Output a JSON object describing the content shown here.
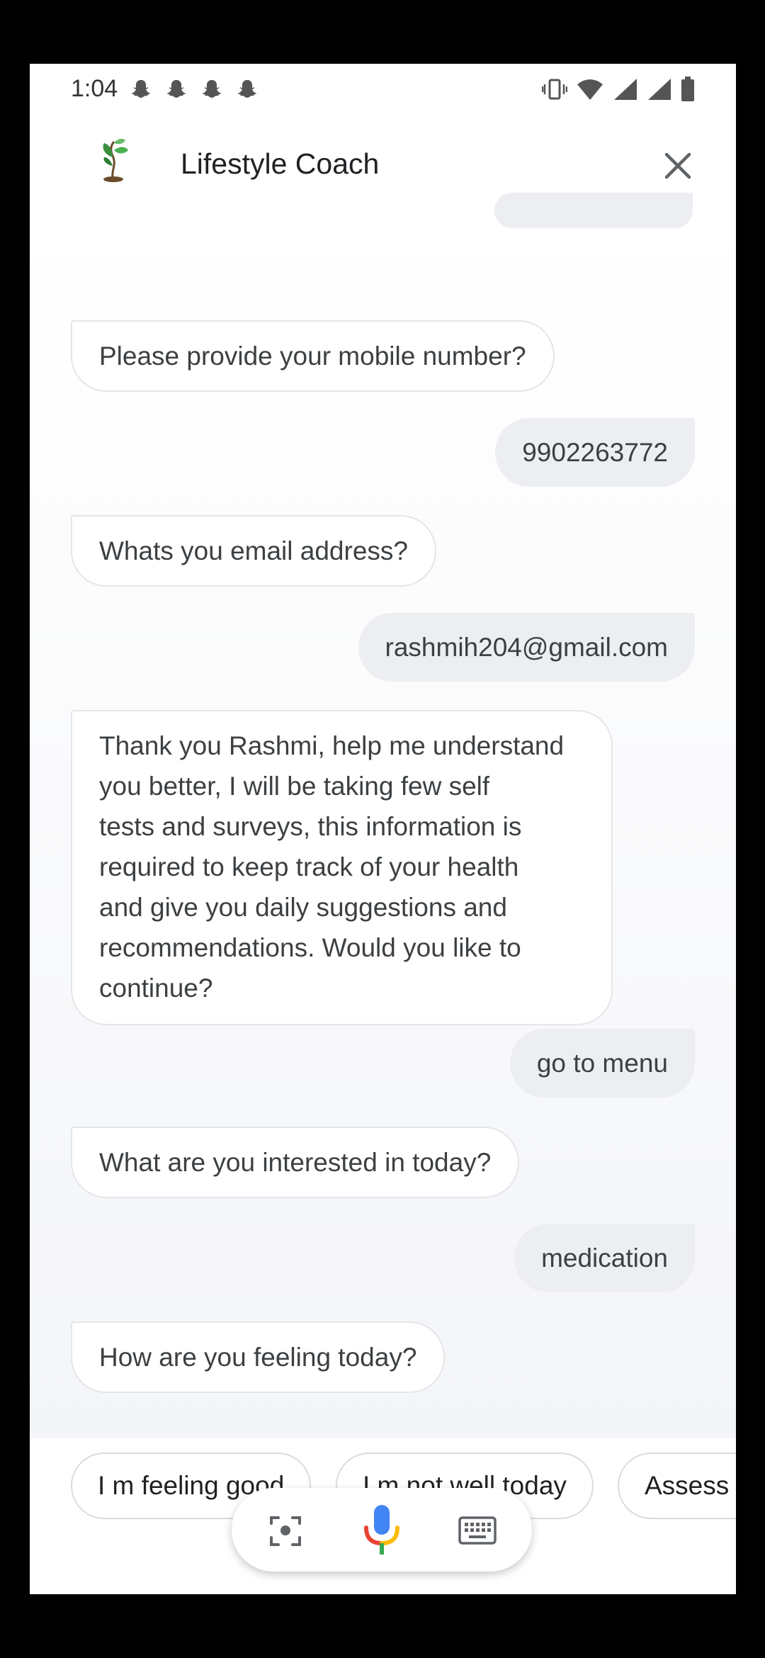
{
  "status_bar": {
    "time": "1:04"
  },
  "header": {
    "title": "Lifestyle Coach",
    "icons": [
      "plant-logo-icon",
      "close-icon"
    ]
  },
  "messages": [
    {
      "from": "bot",
      "text": "Please provide your mobile number?"
    },
    {
      "from": "user",
      "text": "9902263772"
    },
    {
      "from": "bot",
      "text": "Whats you email address?"
    },
    {
      "from": "user",
      "text": "rashmih204@gmail.com"
    },
    {
      "from": "bot",
      "lines": [
        "Thank you Rashmi, help me understand",
        "you better, I will be taking few self",
        "tests and surveys, this information is",
        "required to keep track of your health",
        "and give you daily suggestions and",
        "recommendations. Would you like to",
        "continue?"
      ]
    },
    {
      "from": "user",
      "text": "go to menu"
    },
    {
      "from": "bot",
      "text": "What are  you interested in today?"
    },
    {
      "from": "user",
      "text": "medication"
    },
    {
      "from": "bot",
      "text": "How are you feeling today?"
    }
  ],
  "suggestions": [
    "I m feeling good",
    "I m not well today",
    "Assess"
  ],
  "input_bar": {
    "icons": [
      "lens-icon",
      "mic-icon",
      "keyboard-icon"
    ]
  },
  "colors": {
    "google_blue": "#4285F4",
    "google_red": "#EA4335",
    "google_yellow": "#FBBC04",
    "google_green": "#34A853"
  }
}
